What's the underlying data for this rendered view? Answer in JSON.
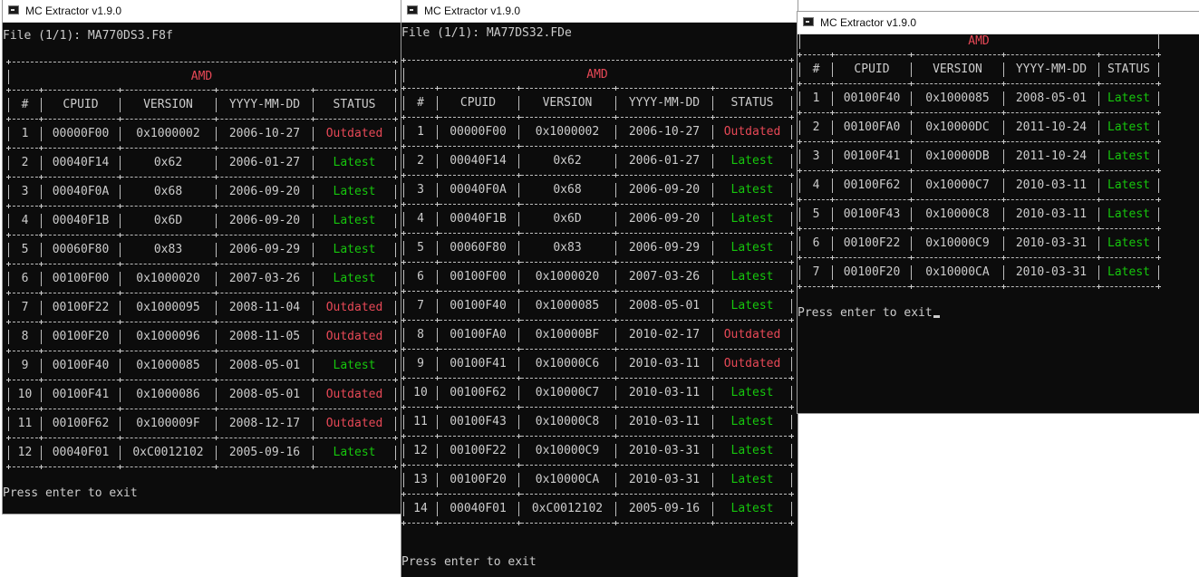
{
  "windows": [
    {
      "title": "MC Extractor v1.9.0",
      "file_line": "File (1/1): MA770DS3.F8f",
      "table": {
        "vendor": "AMD",
        "headers": [
          "#",
          "CPUID",
          "VERSION",
          "YYYY-MM-DD",
          "STATUS"
        ],
        "rows": [
          [
            "1",
            "00000F00",
            "0x1000002",
            "2006-10-27",
            "Outdated"
          ],
          [
            "2",
            "00040F14",
            "0x62",
            "2006-01-27",
            "Latest"
          ],
          [
            "3",
            "00040F0A",
            "0x68",
            "2006-09-20",
            "Latest"
          ],
          [
            "4",
            "00040F1B",
            "0x6D",
            "2006-09-20",
            "Latest"
          ],
          [
            "5",
            "00060F80",
            "0x83",
            "2006-09-29",
            "Latest"
          ],
          [
            "6",
            "00100F00",
            "0x1000020",
            "2007-03-26",
            "Latest"
          ],
          [
            "7",
            "00100F22",
            "0x1000095",
            "2008-11-04",
            "Outdated"
          ],
          [
            "8",
            "00100F20",
            "0x1000096",
            "2008-11-05",
            "Outdated"
          ],
          [
            "9",
            "00100F40",
            "0x1000085",
            "2008-05-01",
            "Latest"
          ],
          [
            "10",
            "00100F41",
            "0x1000086",
            "2008-05-01",
            "Outdated"
          ],
          [
            "11",
            "00100F62",
            "0x100009F",
            "2008-12-17",
            "Outdated"
          ],
          [
            "12",
            "00040F01",
            "0xC0012102",
            "2005-09-16",
            "Latest"
          ]
        ]
      },
      "prompt": "Press enter to exit"
    },
    {
      "title": "MC Extractor v1.9.0",
      "file_line": "File (1/1): MA77DS32.FDe",
      "table": {
        "vendor": "AMD",
        "headers": [
          "#",
          "CPUID",
          "VERSION",
          "YYYY-MM-DD",
          "STATUS"
        ],
        "rows": [
          [
            "1",
            "00000F00",
            "0x1000002",
            "2006-10-27",
            "Outdated"
          ],
          [
            "2",
            "00040F14",
            "0x62",
            "2006-01-27",
            "Latest"
          ],
          [
            "3",
            "00040F0A",
            "0x68",
            "2006-09-20",
            "Latest"
          ],
          [
            "4",
            "00040F1B",
            "0x6D",
            "2006-09-20",
            "Latest"
          ],
          [
            "5",
            "00060F80",
            "0x83",
            "2006-09-29",
            "Latest"
          ],
          [
            "6",
            "00100F00",
            "0x1000020",
            "2007-03-26",
            "Latest"
          ],
          [
            "7",
            "00100F40",
            "0x1000085",
            "2008-05-01",
            "Latest"
          ],
          [
            "8",
            "00100FA0",
            "0x10000BF",
            "2010-02-17",
            "Outdated"
          ],
          [
            "9",
            "00100F41",
            "0x10000C6",
            "2010-03-11",
            "Outdated"
          ],
          [
            "10",
            "00100F62",
            "0x10000C7",
            "2010-03-11",
            "Latest"
          ],
          [
            "11",
            "00100F43",
            "0x10000C8",
            "2010-03-11",
            "Latest"
          ],
          [
            "12",
            "00100F22",
            "0x10000C9",
            "2010-03-31",
            "Latest"
          ],
          [
            "13",
            "00100F20",
            "0x10000CA",
            "2010-03-31",
            "Latest"
          ],
          [
            "14",
            "00040F01",
            "0xC0012102",
            "2005-09-16",
            "Latest"
          ]
        ]
      },
      "prompt": "Press enter to exit"
    },
    {
      "title": "MC Extractor v1.9.0",
      "file_line": "",
      "table": {
        "vendor": "AMD",
        "headers": [
          "#",
          "CPUID",
          "VERSION",
          "YYYY-MM-DD",
          "STATUS"
        ],
        "rows": [
          [
            "1",
            "00100F40",
            "0x1000085",
            "2008-05-01",
            "Latest"
          ],
          [
            "2",
            "00100FA0",
            "0x10000DC",
            "2011-10-24",
            "Latest"
          ],
          [
            "3",
            "00100F41",
            "0x10000DB",
            "2011-10-24",
            "Latest"
          ],
          [
            "4",
            "00100F62",
            "0x10000C7",
            "2010-03-11",
            "Latest"
          ],
          [
            "5",
            "00100F43",
            "0x10000C8",
            "2010-03-11",
            "Latest"
          ],
          [
            "6",
            "00100F22",
            "0x10000C9",
            "2010-03-31",
            "Latest"
          ],
          [
            "7",
            "00100F20",
            "0x10000CA",
            "2010-03-31",
            "Latest"
          ]
        ]
      },
      "prompt": "Press enter to exit"
    }
  ],
  "colors": {
    "console_bg": "#0c0c0c",
    "console_text": "#cccccc",
    "vendor_red": "#e74856",
    "latest_green": "#16c60c",
    "outdated_red": "#e74856"
  }
}
